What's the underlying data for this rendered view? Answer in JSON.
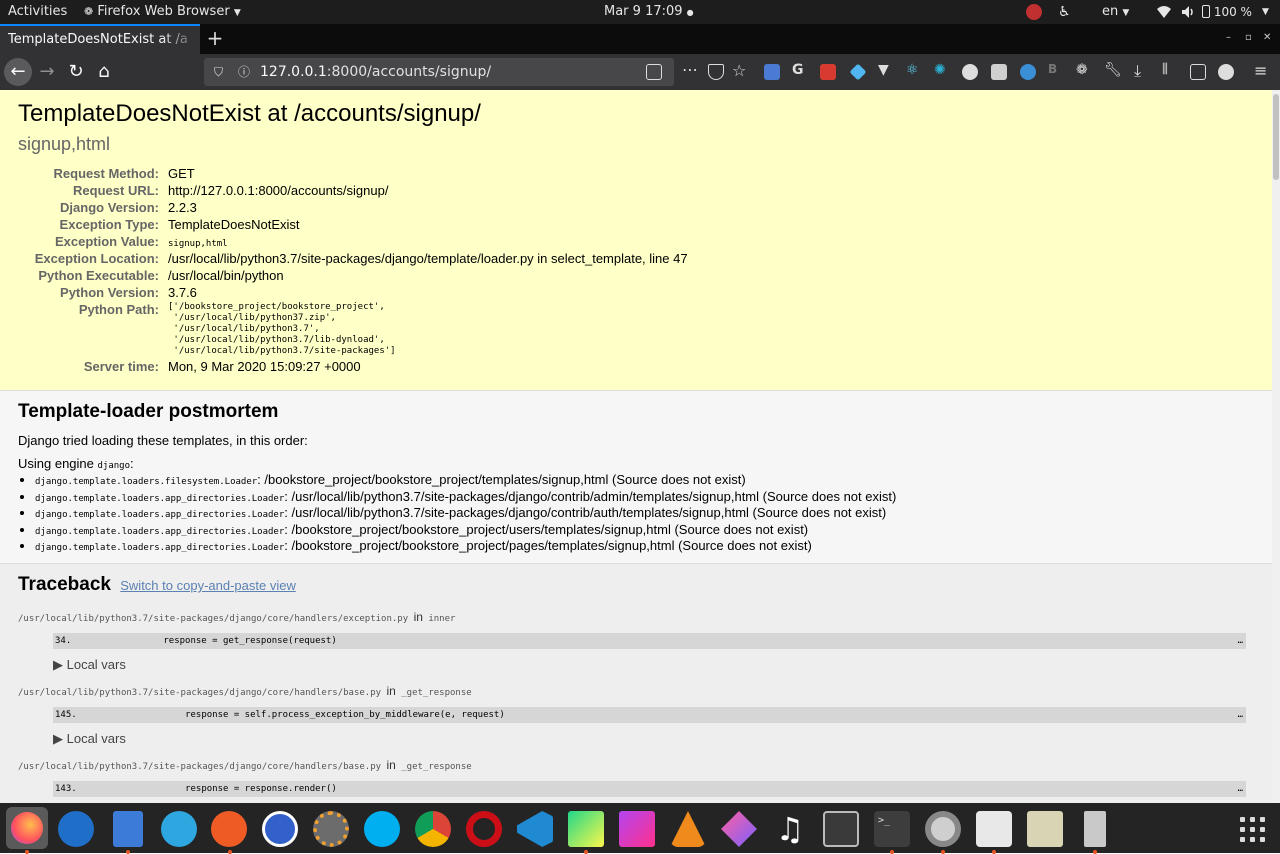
{
  "topbar": {
    "activities": "Activities",
    "app_name": "Firefox Web Browser",
    "clock": "Mar 9  17:09",
    "language": "en",
    "battery": "100 %"
  },
  "browser": {
    "tab_title": "TemplateDoesNotExist at /a",
    "url_host": "127.0.0.1",
    "url_rest": ":8000/accounts/signup/"
  },
  "summary": {
    "title": "TemplateDoesNotExist at /accounts/signup/",
    "subtitle": "signup,html",
    "rows": [
      {
        "label": "Request Method:",
        "value": "GET"
      },
      {
        "label": "Request URL:",
        "value": "http://127.0.0.1:8000/accounts/signup/"
      },
      {
        "label": "Django Version:",
        "value": "2.2.3"
      },
      {
        "label": "Exception Type:",
        "value": "TemplateDoesNotExist"
      },
      {
        "label": "Exception Value:",
        "value": "signup,html"
      },
      {
        "label": "Exception Location:",
        "value": "/usr/local/lib/python3.7/site-packages/django/template/loader.py in select_template, line 47"
      },
      {
        "label": "Python Executable:",
        "value": "/usr/local/bin/python"
      },
      {
        "label": "Python Version:",
        "value": "3.7.6"
      },
      {
        "label": "Python Path:",
        "value": "['/bookstore_project/bookstore_project',\n '/usr/local/lib/python37.zip',\n '/usr/local/lib/python3.7',\n '/usr/local/lib/python3.7/lib-dynload',\n '/usr/local/lib/python3.7/site-packages']"
      },
      {
        "label": "Server time:",
        "value": "Mon, 9 Mar 2020 15:09:27 +0000"
      }
    ]
  },
  "postmortem": {
    "heading": "Template-loader postmortem",
    "intro": "Django tried loading these templates, in this order:",
    "engine_prefix": "Using engine ",
    "engine_name": "django",
    "engine_suffix": ":",
    "items": [
      {
        "loader": "django.template.loaders.filesystem.Loader",
        "path": "/bookstore_project/bookstore_project/templates/signup,html (Source does not exist)"
      },
      {
        "loader": "django.template.loaders.app_directories.Loader",
        "path": "/usr/local/lib/python3.7/site-packages/django/contrib/admin/templates/signup,html (Source does not exist)"
      },
      {
        "loader": "django.template.loaders.app_directories.Loader",
        "path": "/usr/local/lib/python3.7/site-packages/django/contrib/auth/templates/signup,html (Source does not exist)"
      },
      {
        "loader": "django.template.loaders.app_directories.Loader",
        "path": "/bookstore_project/bookstore_project/users/templates/signup,html (Source does not exist)"
      },
      {
        "loader": "django.template.loaders.app_directories.Loader",
        "path": "/bookstore_project/bookstore_project/pages/templates/signup,html (Source does not exist)"
      }
    ]
  },
  "traceback": {
    "heading": "Traceback",
    "switch_link": "Switch to copy-and-paste view",
    "in_word": "in",
    "local_vars": "▶ Local vars",
    "ellipsis": "…",
    "frames": [
      {
        "file": "/usr/local/lib/python3.7/site-packages/django/core/handlers/exception.py",
        "func": "inner",
        "lineno": "34.",
        "code": "            response = get_response(request)"
      },
      {
        "file": "/usr/local/lib/python3.7/site-packages/django/core/handlers/base.py",
        "func": "_get_response",
        "lineno": "145.",
        "code": "                response = self.process_exception_by_middleware(e, request)"
      },
      {
        "file": "/usr/local/lib/python3.7/site-packages/django/core/handlers/base.py",
        "func": "_get_response",
        "lineno": "143.",
        "code": "                response = response.render()"
      }
    ]
  },
  "dock": {
    "apps": [
      "firefox-icon",
      "thunderbird-icon",
      "files-icon",
      "telegram-icon",
      "postman-icon",
      "simplenote-icon",
      "settings-icon",
      "skype-icon",
      "chrome-icon",
      "opera-icon",
      "vscode-icon",
      "pycharm-icon",
      "phpstorm-icon",
      "vlc-icon",
      "kite-icon",
      "music-icon",
      "system-monitor-icon",
      "terminal-icon",
      "disk-utility-icon",
      "image-viewer-icon",
      "text-editor-icon",
      "usb-drive-icon"
    ]
  }
}
